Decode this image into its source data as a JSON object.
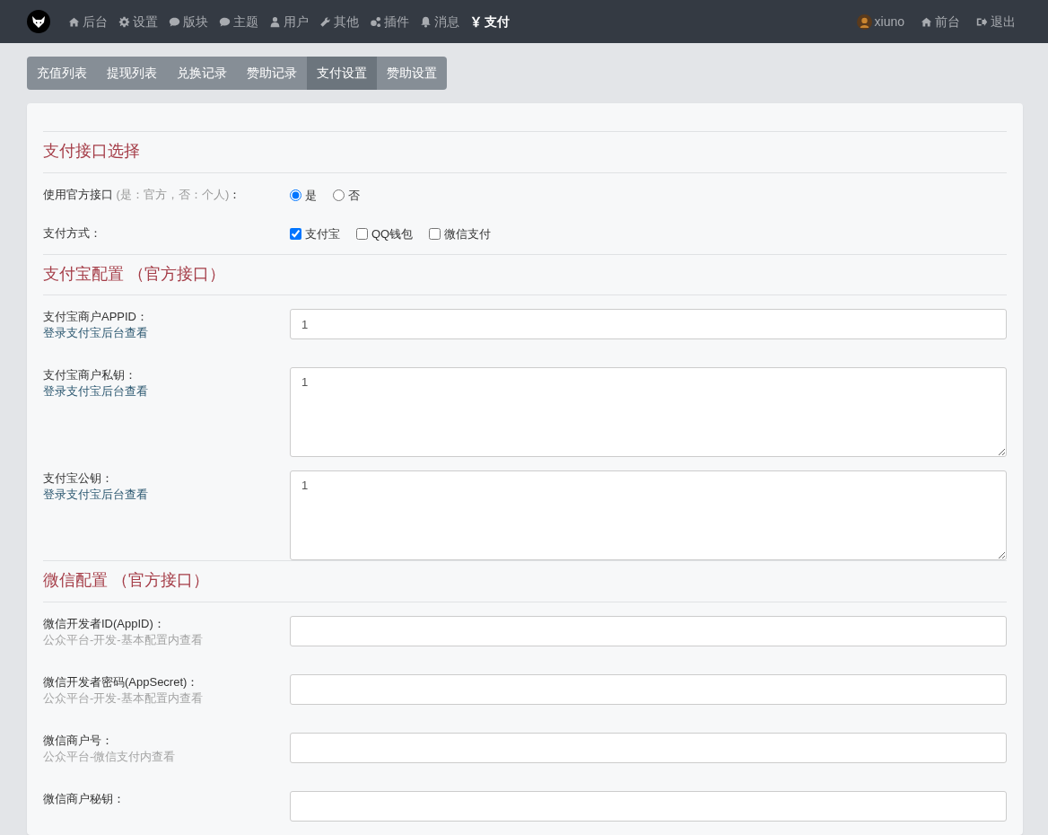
{
  "navbar": {
    "left": [
      {
        "label": "后台",
        "selected": false
      },
      {
        "label": "设置",
        "selected": false
      },
      {
        "label": "版块",
        "selected": false
      },
      {
        "label": "主题",
        "selected": false
      },
      {
        "label": "用户",
        "selected": false
      },
      {
        "label": "其他",
        "selected": false
      },
      {
        "label": "插件",
        "selected": false
      },
      {
        "label": "消息",
        "selected": false
      },
      {
        "label": "支付",
        "selected": true
      }
    ],
    "right": [
      {
        "label": "xiuno"
      },
      {
        "label": "前台"
      },
      {
        "label": "退出"
      }
    ]
  },
  "tabs": [
    {
      "label": "充值列表",
      "selected": false
    },
    {
      "label": "提现列表",
      "selected": false
    },
    {
      "label": "兑换记录",
      "selected": false
    },
    {
      "label": "赞助记录",
      "selected": false
    },
    {
      "label": "支付设置",
      "selected": true
    },
    {
      "label": "赞助设置",
      "selected": false
    }
  ],
  "sections": [
    {
      "title": "支付接口选择",
      "rows": [
        {
          "kind": "radio",
          "label": "使用官方接口",
          "note": "(是：官方，否：个人)",
          "suffix": "：",
          "options": [
            {
              "label": "是",
              "selected": true
            },
            {
              "label": "否",
              "selected": false
            }
          ]
        },
        {
          "kind": "checkbox",
          "label": "支付方式：",
          "options": [
            {
              "label": "支付宝",
              "checked": true
            },
            {
              "label": "QQ钱包",
              "checked": false
            },
            {
              "label": "微信支付",
              "checked": false
            }
          ]
        }
      ]
    },
    {
      "title": "支付宝配置 （官方接口）",
      "rows": [
        {
          "kind": "input",
          "label": "支付宝商户APPID：",
          "hint": "登录支付宝后台查看",
          "color": "#2b5770",
          "value": "1"
        },
        {
          "kind": "textarea",
          "label": "支付宝商户私钥：",
          "hint": "登录支付宝后台查看",
          "color": "#2b5770",
          "value": "1"
        },
        {
          "kind": "textarea",
          "label": "支付宝公钥：",
          "hint": "登录支付宝后台查看",
          "color": "#2b5770",
          "value": "1"
        }
      ]
    },
    {
      "title": "微信配置 （官方接口）",
      "rows": [
        {
          "kind": "input",
          "label": "微信开发者ID(AppID)：",
          "hint": "公众平台-开发-基本配置内查看",
          "color": "#a4a4a4"
        },
        {
          "kind": "input",
          "label": "微信开发者密码(AppSecret)：",
          "hint": "公众平台-开发-基本配置内查看",
          "color": "#a4a4a4"
        },
        {
          "kind": "input",
          "label": "微信商户号：",
          "hint": "公众平台-微信支付内查看",
          "color": "#a4a4a4"
        },
        {
          "kind": "input",
          "label": "微信商户秘钥："
        }
      ]
    }
  ]
}
